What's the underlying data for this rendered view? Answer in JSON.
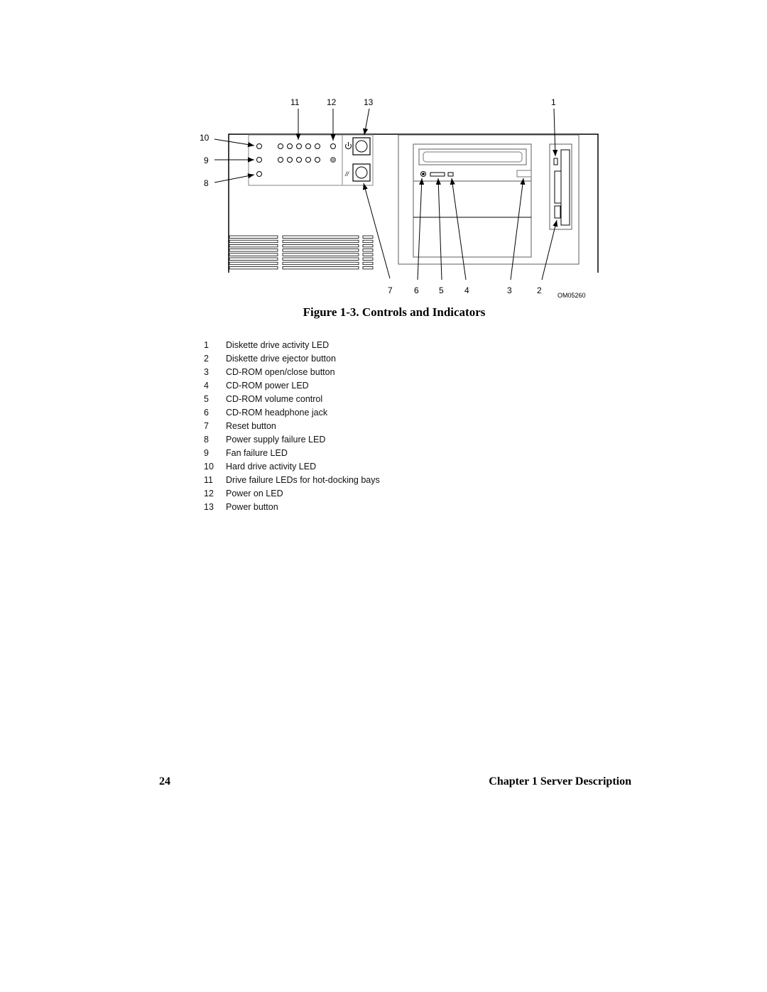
{
  "diagram": {
    "callouts": [
      "1",
      "2",
      "3",
      "4",
      "5",
      "6",
      "7",
      "8",
      "9",
      "10",
      "11",
      "12",
      "13"
    ],
    "figure_id": "OM05260",
    "icons": {
      "power": "power-symbol-icon",
      "reset": "reset-symbol-icon"
    },
    "reset_glyph": "//"
  },
  "figure": {
    "caption": "Figure 1-3.  Controls and Indicators"
  },
  "legend": [
    {
      "num": "1",
      "text": "Diskette drive activity LED"
    },
    {
      "num": "2",
      "text": "Diskette drive ejector button"
    },
    {
      "num": "3",
      "text": "CD-ROM open/close button"
    },
    {
      "num": "4",
      "text": "CD-ROM power LED"
    },
    {
      "num": "5",
      "text": "CD-ROM volume control"
    },
    {
      "num": "6",
      "text": "CD-ROM headphone jack"
    },
    {
      "num": "7",
      "text": "Reset button"
    },
    {
      "num": "8",
      "text": "Power supply failure LED"
    },
    {
      "num": "9",
      "text": "Fan failure LED"
    },
    {
      "num": "10",
      "text": "Hard drive activity LED"
    },
    {
      "num": "11",
      "text": "Drive failure LEDs for hot-docking bays"
    },
    {
      "num": "12",
      "text": "Power on LED"
    },
    {
      "num": "13",
      "text": "Power button"
    }
  ],
  "footer": {
    "page_number": "24",
    "chapter": "Chapter 1  Server Description"
  }
}
